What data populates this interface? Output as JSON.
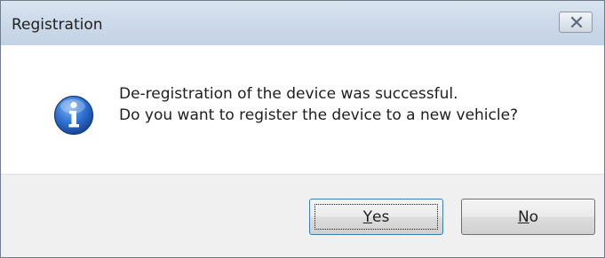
{
  "dialog": {
    "title": "Registration",
    "close_icon": "close-icon",
    "icon": "information-icon",
    "message_line1": "De-registration of the device was successful.",
    "message_line2": "Do you want to register the device to a new vehicle?"
  },
  "buttons": {
    "yes": {
      "accel": "Y",
      "rest": "es"
    },
    "no": {
      "accel": "N",
      "rest": "o"
    }
  },
  "colors": {
    "titlebar": "#cddaea",
    "footer": "#f0f0f0",
    "info_icon_blue": "#1f5fb8"
  }
}
